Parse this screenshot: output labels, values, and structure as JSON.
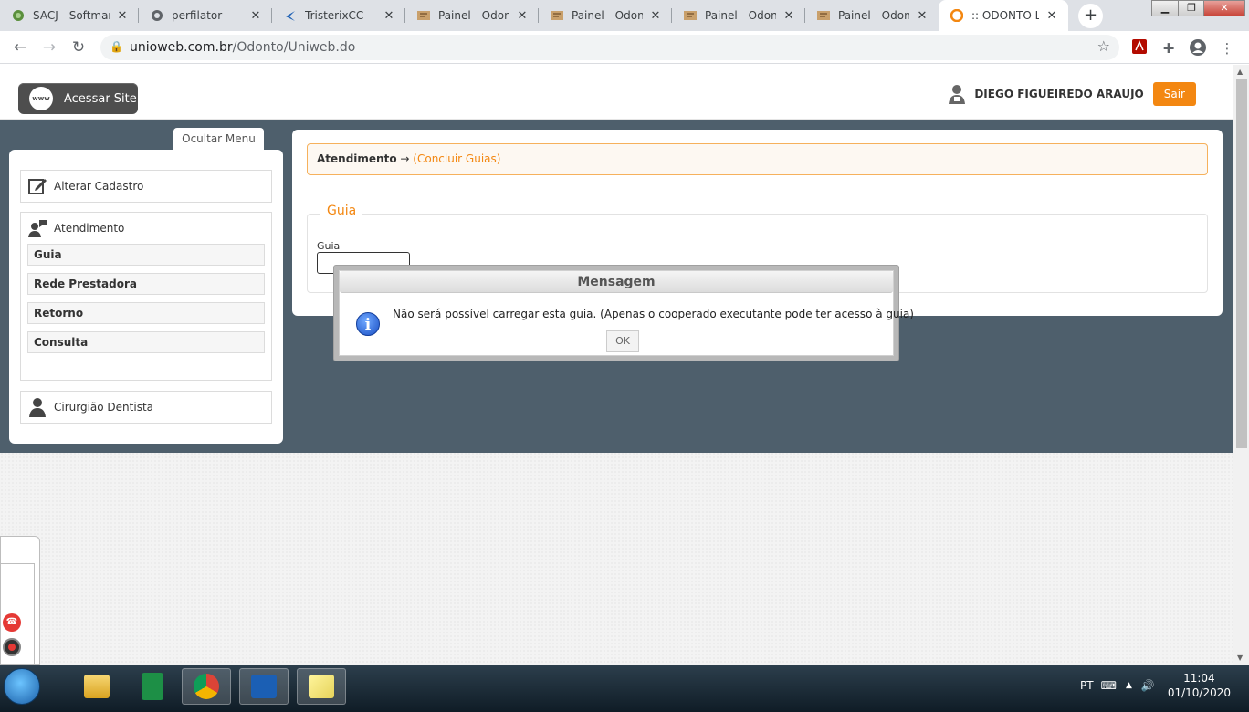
{
  "browser": {
    "tabs": [
      {
        "title": "SACJ - Softmarl",
        "favicon": "globe-green-icon"
      },
      {
        "title": "perfilator",
        "favicon": "globe-icon"
      },
      {
        "title": "TristerixCC",
        "favicon": "tristerix-icon"
      },
      {
        "title": "Painel - Odontc",
        "favicon": "odonto-panel-icon"
      },
      {
        "title": "Painel - Odontc",
        "favicon": "odonto-panel-icon"
      },
      {
        "title": "Painel - Odontc",
        "favicon": "odonto-panel-icon"
      },
      {
        "title": "Painel - Odontc",
        "favicon": "odonto-panel-icon"
      },
      {
        "title": ":: ODONTO LIF",
        "favicon": "odonto-life-icon"
      }
    ],
    "active_tab_index": 7,
    "url_host": "unioweb.com.br",
    "url_path": "/Odonto/Uniweb.do"
  },
  "header": {
    "site_button": "Acessar Site",
    "site_icon_text": "www",
    "user_name": "DIEGO FIGUEIREDO ARAUJO",
    "logout": "Sair"
  },
  "sidebar": {
    "hide_menu": "Ocultar Menu",
    "alterar_cadastro": "Alterar Cadastro",
    "atendimento": "Atendimento",
    "atendimento_items": [
      "Guia",
      "Rede Prestadora",
      "Retorno",
      "Consulta"
    ],
    "cirurgiao": "Cirurgião Dentista"
  },
  "main": {
    "breadcrumb_root": "Atendimento",
    "breadcrumb_arrow": "→",
    "breadcrumb_current": "(Concluir Guias)",
    "fieldset_legend": "Guia",
    "field_label": "Guia",
    "field_value": ""
  },
  "modal": {
    "title": "Mensagem",
    "text": "Não será possível carregar esta guia. (Apenas o cooperado executante pode ter acesso à guia)",
    "ok": "OK"
  },
  "taskbar": {
    "lang": "PT",
    "time": "11:04",
    "date": "01/10/2020"
  },
  "colors": {
    "accent_orange": "#f38711",
    "band": "#4e5f6c"
  }
}
